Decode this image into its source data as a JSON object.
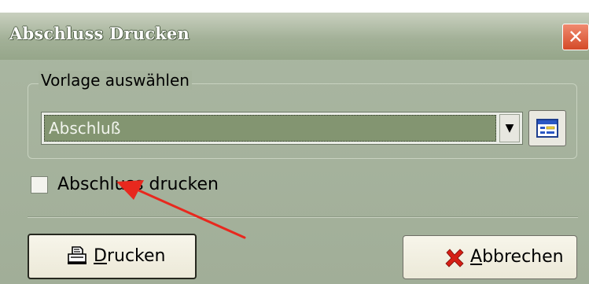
{
  "window": {
    "title": "Abschluss Drucken",
    "close_glyph": "✕"
  },
  "template_group": {
    "legend": "Vorlage auswählen",
    "selected": "Abschluß",
    "dropdown_arrow": "▼",
    "edit_icon": "form-edit-icon"
  },
  "option": {
    "checkbox_label": "Abschluss drucken",
    "checked": false
  },
  "buttons": {
    "print_underline": "D",
    "print_rest": "rucken",
    "print_icon": "printer-icon",
    "cancel_underline": "A",
    "cancel_rest": "bbrechen",
    "cancel_icon": "red-x-icon"
  },
  "annotation": {
    "arrow_color": "#e8281e"
  }
}
